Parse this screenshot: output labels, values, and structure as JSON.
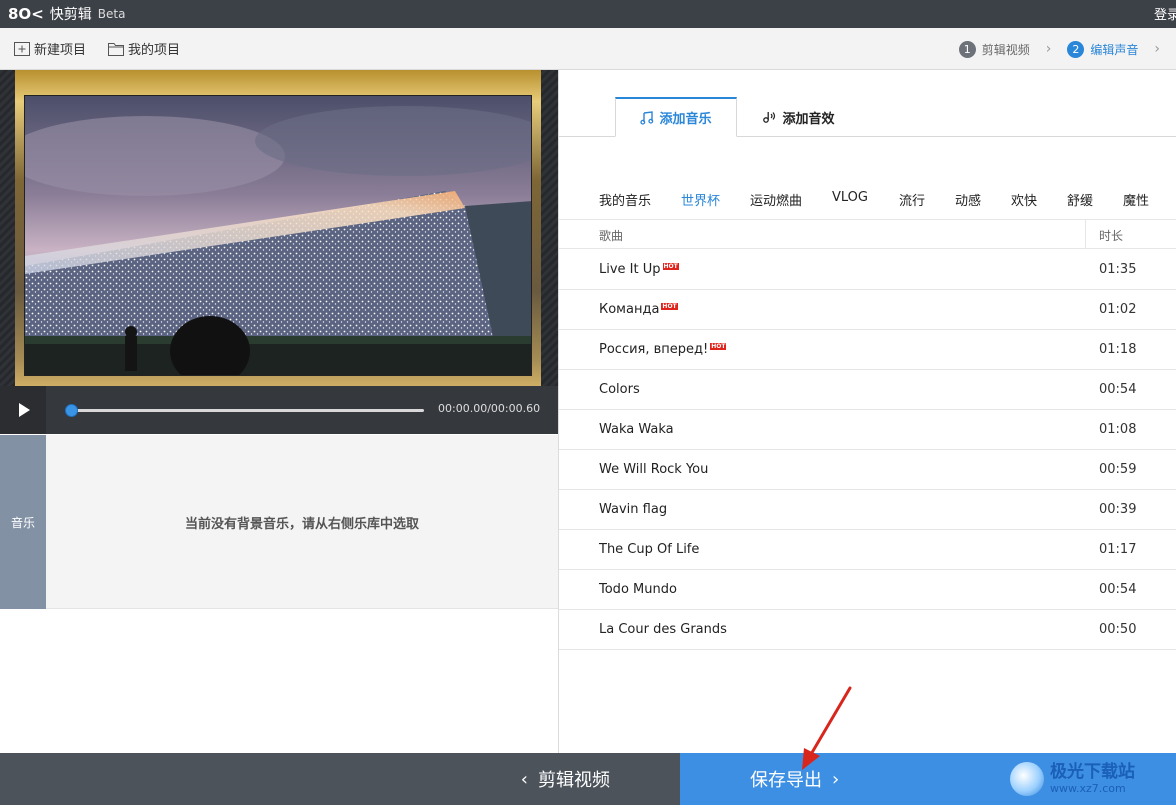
{
  "titlebar": {
    "app_name": "快剪辑",
    "beta": "Beta",
    "login": "登录"
  },
  "toolbar": {
    "new_project": "新建项目",
    "my_projects": "我的项目",
    "steps": [
      {
        "num": "1",
        "label": "剪辑视频"
      },
      {
        "num": "2",
        "label": "编辑声音"
      }
    ]
  },
  "player": {
    "time": "00:00.00/00:00.60",
    "progress": 0
  },
  "music_track": {
    "label": "音乐",
    "empty_text": "当前没有背景音乐，请从右侧乐库中选取"
  },
  "library": {
    "tabs": [
      {
        "label": "添加音乐",
        "icon": "music-note-icon"
      },
      {
        "label": "添加音效",
        "icon": "sound-effect-icon"
      }
    ],
    "categories": [
      "我的音乐",
      "世界杯",
      "运动燃曲",
      "VLOG",
      "流行",
      "动感",
      "欢快",
      "舒缓",
      "魔性"
    ],
    "active_category": "世界杯",
    "columns": {
      "song": "歌曲",
      "duration": "时长"
    },
    "hot_badge": "HOT",
    "songs": [
      {
        "title": "Live It Up",
        "duration": "01:35",
        "hot": true
      },
      {
        "title": "Команда",
        "duration": "01:02",
        "hot": true
      },
      {
        "title": "Россия, вперед!",
        "duration": "01:18",
        "hot": true
      },
      {
        "title": "Colors",
        "duration": "00:54",
        "hot": false
      },
      {
        "title": "Waka Waka",
        "duration": "01:08",
        "hot": false
      },
      {
        "title": "We Will Rock You",
        "duration": "00:59",
        "hot": false
      },
      {
        "title": "Wavin flag",
        "duration": "00:39",
        "hot": false
      },
      {
        "title": "The Cup Of Life",
        "duration": "01:17",
        "hot": false
      },
      {
        "title": "Todo Mundo",
        "duration": "00:54",
        "hot": false
      },
      {
        "title": "La Cour des Grands",
        "duration": "00:50",
        "hot": false
      }
    ]
  },
  "bottom": {
    "back_label": "剪辑视频",
    "save_label": "保存导出"
  },
  "watermark": {
    "title": "极光下载站",
    "url": "www.xz7.com"
  },
  "colors": {
    "accent": "#2a86d8",
    "save_button": "#3d8fe3",
    "hot_badge": "#e0241b",
    "annotation_arrow": "#d9261c"
  }
}
